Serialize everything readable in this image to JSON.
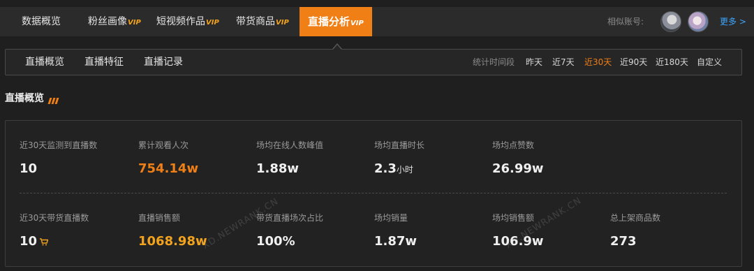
{
  "nav": {
    "tabs": [
      {
        "label": "数据概览",
        "vip": ""
      },
      {
        "label": "粉丝画像",
        "vip": "VIP"
      },
      {
        "label": "短视频作品",
        "vip": "VIP"
      },
      {
        "label": "带货商品",
        "vip": "VIP"
      },
      {
        "label": "直播分析",
        "vip": "VIP",
        "active": true
      }
    ],
    "similar_label": "相似账号:",
    "more_label": "更多 >"
  },
  "subnav": {
    "tabs": [
      "直播概览",
      "直播特征",
      "直播记录"
    ],
    "period_label": "统计时间段",
    "periods": [
      "昨天",
      "近7天",
      "近30天",
      "近90天",
      "近180天",
      "自定义"
    ],
    "active_period": "近30天"
  },
  "section": {
    "title": "直播概览"
  },
  "stats": {
    "row1": [
      {
        "label": "近30天监测到直播数",
        "value": "10"
      },
      {
        "label": "累计观看人次",
        "value": "754.14w"
      },
      {
        "label": "场均在线人数峰值",
        "value": "1.88w"
      },
      {
        "label": "场均直播时长",
        "value": "2.3",
        "unit": "小时"
      },
      {
        "label": "场均点赞数",
        "value": "26.99w"
      }
    ],
    "row2": [
      {
        "label": "近30天带货直播数",
        "value": "10"
      },
      {
        "label": "直播销售额",
        "value": "1068.98w"
      },
      {
        "label": "带货直播场次占比",
        "value": "100%"
      },
      {
        "label": "场均销量",
        "value": "1.87w"
      },
      {
        "label": "场均销售额",
        "value": "106.9w"
      },
      {
        "label": "总上架商品数",
        "value": "273"
      }
    ]
  },
  "watermarks": [
    "XD.NEWRANK.CN",
    "XD.NEWRANK.CN"
  ],
  "colors": {
    "accent": "#f07f16",
    "link": "#3ea6ff",
    "background": "#1f1f1f"
  }
}
